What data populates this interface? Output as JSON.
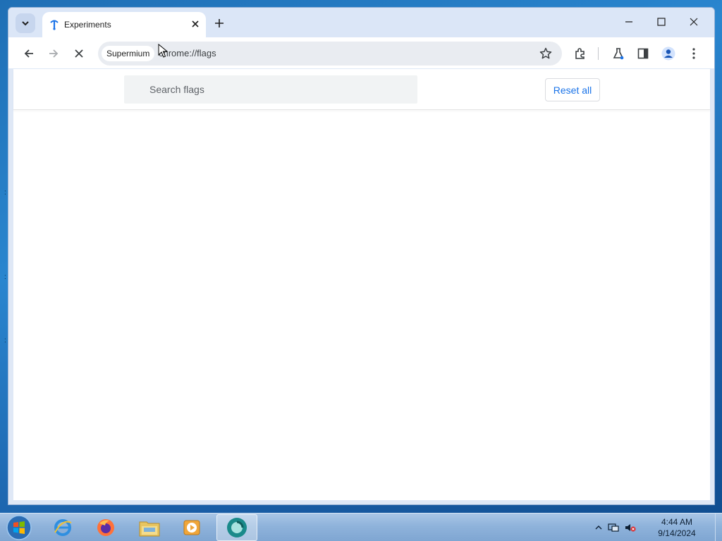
{
  "browser": {
    "tab": {
      "title": "Experiments",
      "favicon": "supermium-icon"
    },
    "controls": {
      "minimize": "minimize-icon",
      "maximize": "maximize-icon",
      "close": "close-icon"
    },
    "toolbar": {
      "omnibox_chip": "Supermium",
      "url": "chrome://flags"
    }
  },
  "flags_page": {
    "search": {
      "placeholder": "Search flags",
      "value": ""
    },
    "reset_label": "Reset all"
  },
  "taskbar": {
    "apps": [
      "internet-explorer-icon",
      "firefox-icon",
      "file-explorer-icon",
      "media-player-icon",
      "supermium-icon"
    ],
    "clock": {
      "time": "4:44 AM",
      "date": "9/14/2024"
    }
  },
  "colors": {
    "accent": "#1a73e8",
    "tabstrip": "#dbe6f7",
    "omnibox": "#e9ecf1"
  }
}
